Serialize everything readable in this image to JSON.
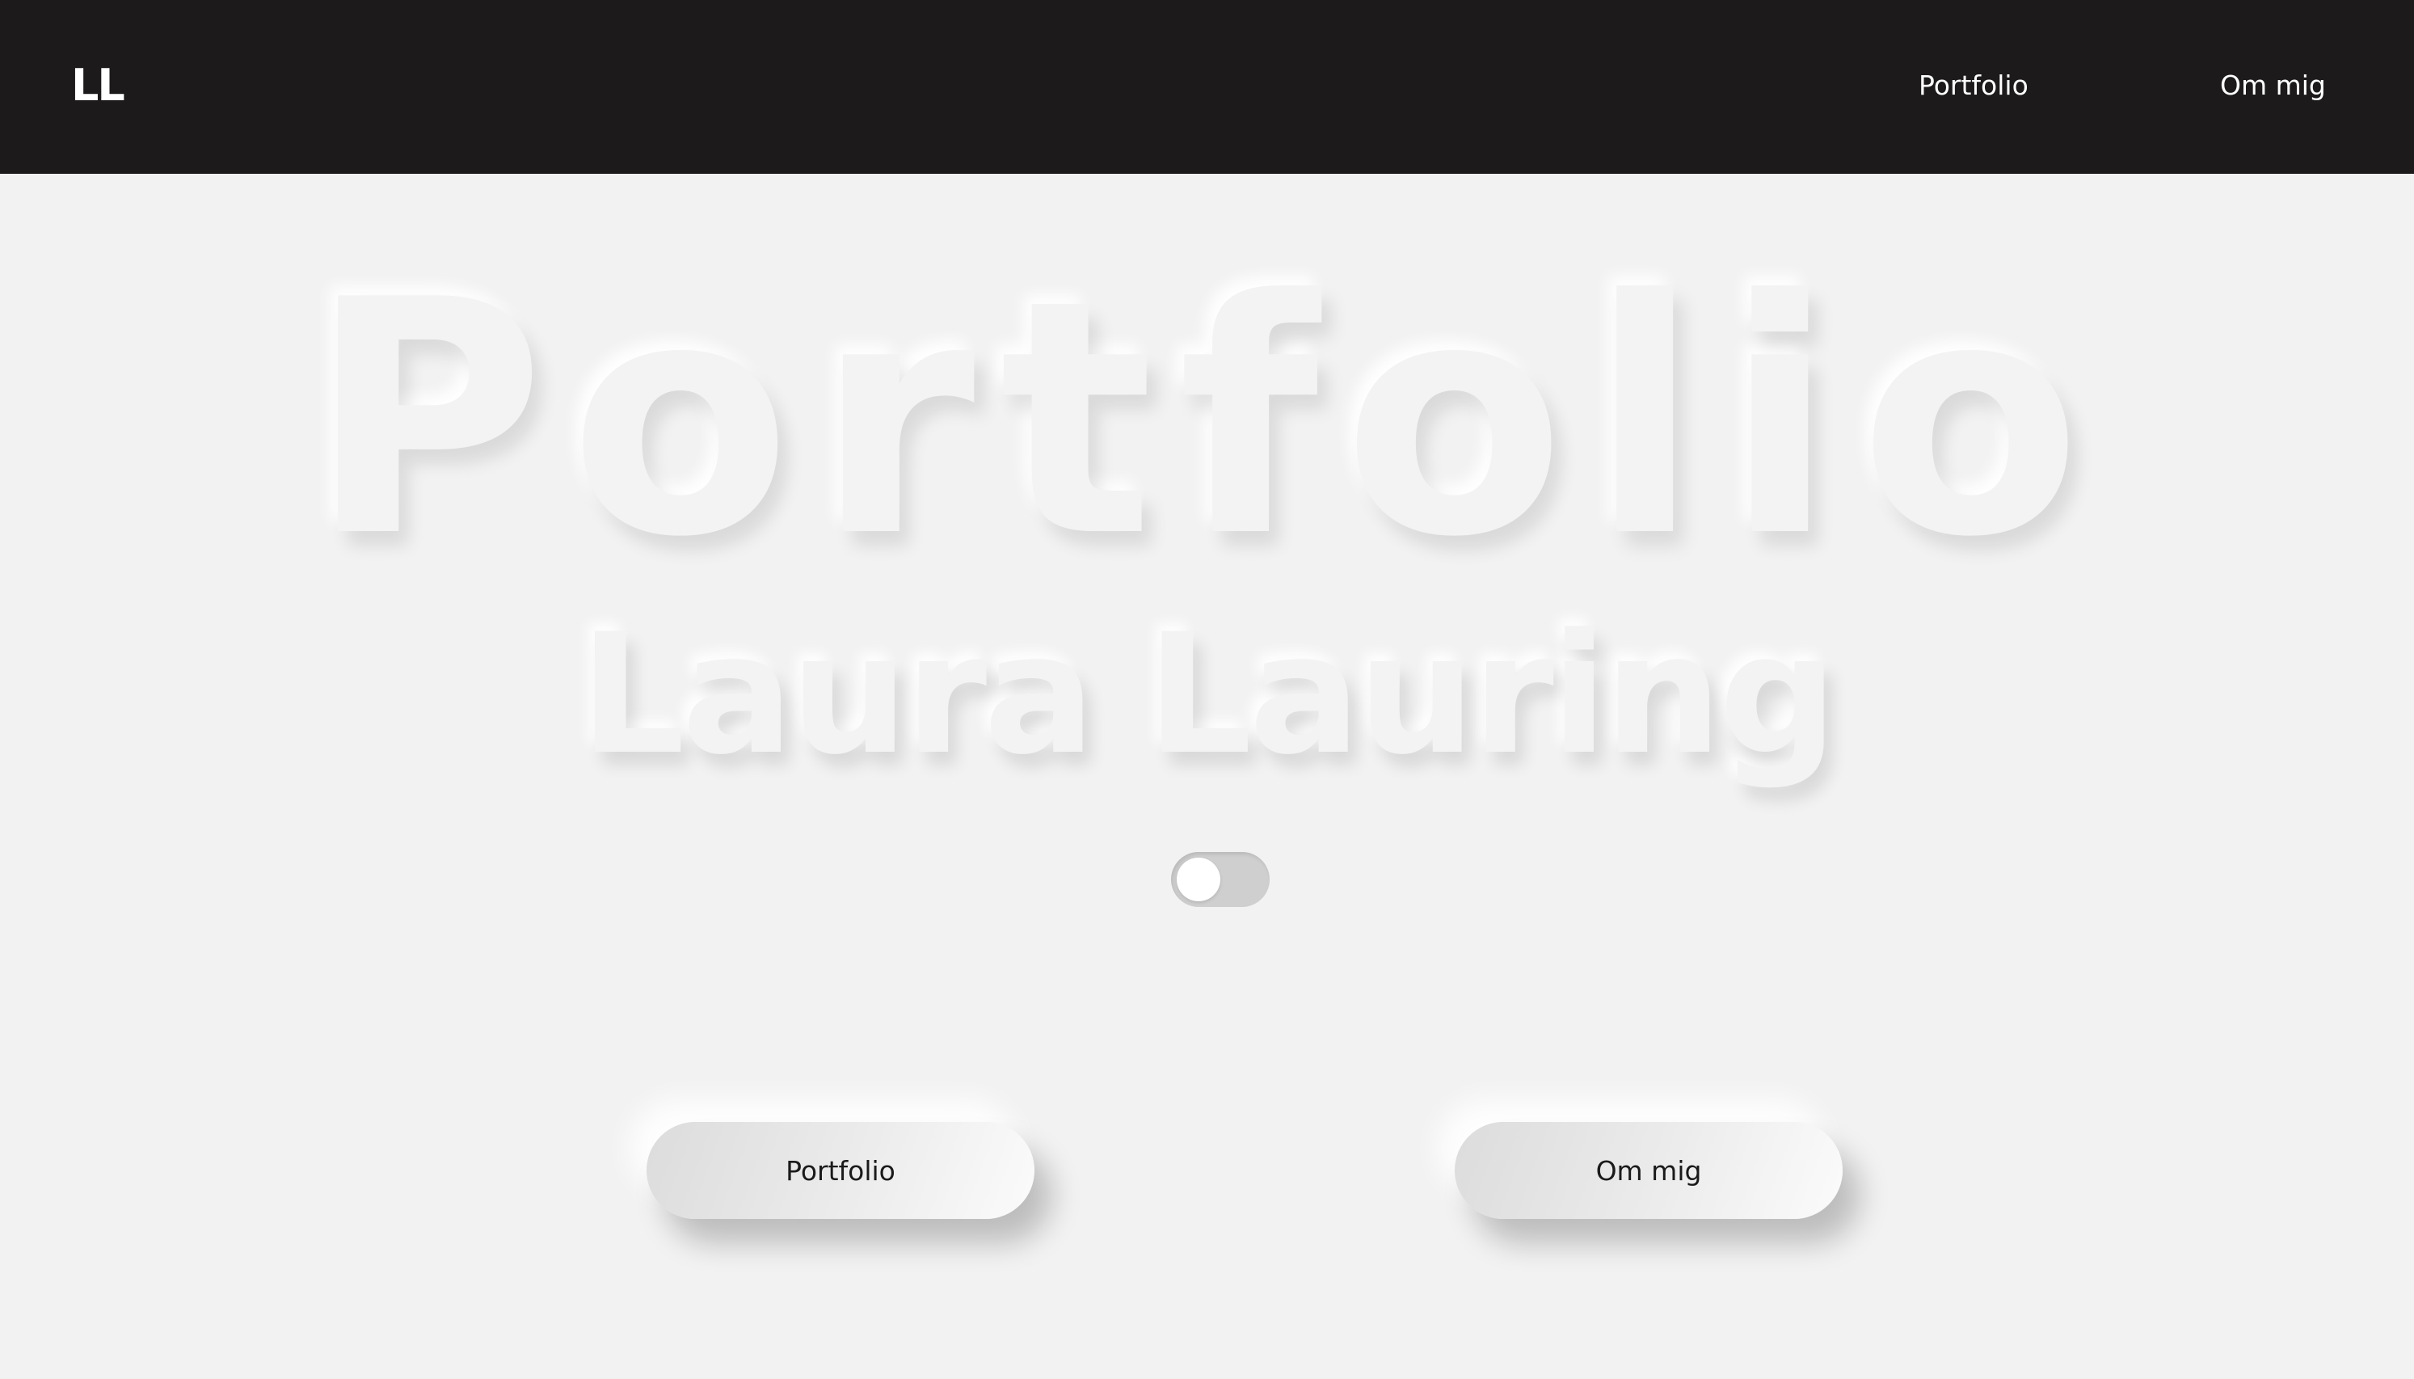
{
  "header": {
    "logo": "LL",
    "nav": {
      "portfolio": "Portfolio",
      "about": "Om mig"
    }
  },
  "hero": {
    "title": "Portfolio",
    "subtitle": "Laura Lauring"
  },
  "theme_toggle": {
    "state": "off"
  },
  "buttons": {
    "portfolio": "Portfolio",
    "about": "Om mig"
  },
  "colors": {
    "header_bg": "#1c1a1b",
    "page_bg": "#f2f2f2",
    "toggle_track": "#cfcfcf"
  }
}
